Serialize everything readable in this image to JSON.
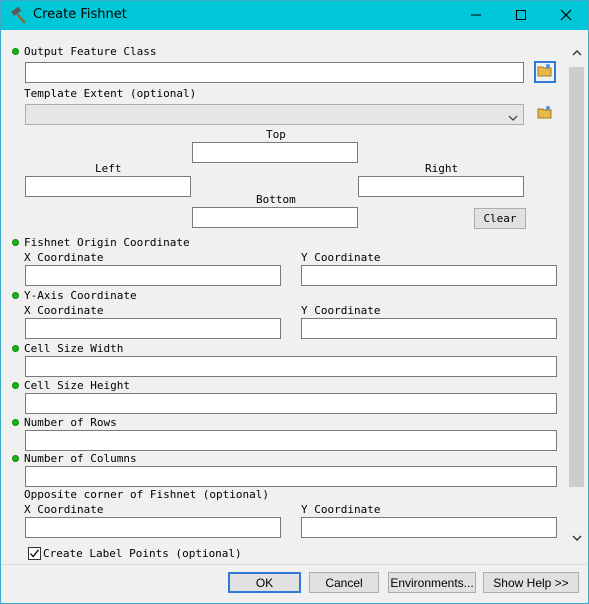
{
  "window": {
    "title": "Create Fishnet",
    "icon": "hammer-icon",
    "controls": [
      "minimize-icon",
      "maximize-icon",
      "close-icon"
    ]
  },
  "params": {
    "output_feature_class": {
      "label": "Output Feature Class",
      "value": ""
    },
    "template_extent": {
      "label": "Template Extent (optional)",
      "value": "",
      "top_label": "Top",
      "left_label": "Left",
      "right_label": "Right",
      "bottom_label": "Bottom",
      "clear_label": "Clear"
    },
    "fishnet_origin": {
      "label": "Fishnet Origin Coordinate",
      "x_label": "X Coordinate",
      "y_label": "Y Coordinate"
    },
    "y_axis": {
      "label": "Y-Axis Coordinate",
      "x_label": "X Coordinate",
      "y_label": "Y Coordinate"
    },
    "cell_width": {
      "label": "Cell Size Width"
    },
    "cell_height": {
      "label": "Cell Size Height"
    },
    "num_rows": {
      "label": "Number of Rows"
    },
    "num_cols": {
      "label": "Number of Columns"
    },
    "opposite_corner": {
      "label": "Opposite corner of Fishnet (optional)",
      "x_label": "X Coordinate",
      "y_label": "Y Coordinate"
    },
    "label_points": {
      "label": "Create Label Points (optional)",
      "checked": true
    }
  },
  "footer": {
    "ok": "OK",
    "cancel": "Cancel",
    "environments": "Environments...",
    "show_help": "Show Help >>"
  },
  "colors": {
    "titlebar": "#00c8d8",
    "required_dot": "#17b317",
    "accent": "#3079d6"
  }
}
